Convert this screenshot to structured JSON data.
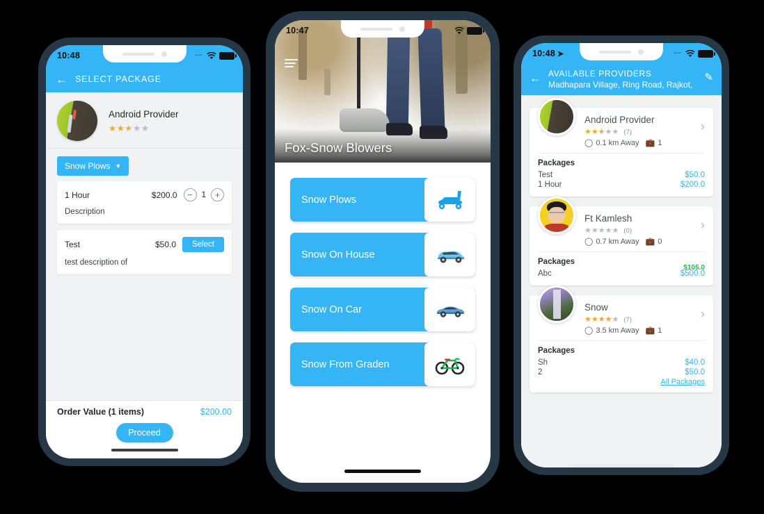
{
  "page": {
    "background": "#000000",
    "phone_frame_color": "#263746",
    "accent": "#35b5f5"
  },
  "phone_left": {
    "status": {
      "time": "10:48",
      "carrier_dots": "••••",
      "wifi_icon": "wifi-icon",
      "battery_icon": "battery-icon"
    },
    "appbar": {
      "back_icon": "back-arrow-icon",
      "title": "SELECT PACKAGE"
    },
    "provider": {
      "name": "Android Provider",
      "avatar_name": "provider-avatar",
      "rating": 2.5,
      "stars": "★★★★★"
    },
    "category_chip": {
      "label": "Snow Plows",
      "caret": "▼"
    },
    "packages": [
      {
        "name": "1 Hour",
        "price": "$200.0",
        "description": "Description",
        "qty": "1",
        "minus": "—",
        "plus": "+",
        "has_stepper": true
      },
      {
        "name": "Test",
        "price": "$50.0",
        "description": "test description of",
        "select_label": "Select",
        "has_stepper": false
      }
    ],
    "footer": {
      "order_label": "Order Value (1 items)",
      "order_value": "$200.00",
      "proceed_label": "Proceed"
    }
  },
  "phone_center": {
    "status": {
      "time": "10:47",
      "wifi_icon": "wifi-icon",
      "battery_icon": "battery-icon"
    },
    "hero": {
      "title": "Fox-Snow Blowers",
      "menu_icon": "hamburger-menu-icon"
    },
    "services": [
      {
        "label": "Snow Plows",
        "icon": "snow-plow-icon"
      },
      {
        "label": "Snow On House",
        "icon": "suv-car-icon"
      },
      {
        "label": "Snow On Car",
        "icon": "sedan-car-icon"
      },
      {
        "label": "Snow From Graden",
        "icon": "bicycle-icon"
      }
    ]
  },
  "phone_right": {
    "status": {
      "time": "10:48",
      "location_icon": "location-arrow-icon",
      "carrier_dots": "••••",
      "wifi_icon": "wifi-icon",
      "battery_icon": "battery-icon"
    },
    "appbar": {
      "back_icon": "back-arrow-icon",
      "title": "AVAILABLE PROVIDERS",
      "subtitle": "Madhapara Village, Ring Road, Rajkot,",
      "edit_icon": "pencil-edit-icon"
    },
    "providers": [
      {
        "name": "Android Provider",
        "avatar_name": "provider-avatar-android",
        "stars_filled": 2.5,
        "rating_count": "(7)",
        "distance": "0.1 km Away",
        "jobs": "1",
        "packages_label": "Packages",
        "packages": [
          {
            "name": "Test",
            "price": "$50.0"
          },
          {
            "name": "1 Hour",
            "price": "$200.0"
          }
        ],
        "extra_price": null,
        "all_packages": null
      },
      {
        "name": "Ft Kamlesh",
        "avatar_name": "provider-avatar-kamlesh",
        "stars_filled": 0,
        "rating_count": "(0)",
        "distance": "0.7 km Away",
        "jobs": "0",
        "packages_label": "Packages",
        "packages": [
          {
            "name": "Abc",
            "price": "$500.0"
          }
        ],
        "extra_price": "$105.0",
        "all_packages": null
      },
      {
        "name": "Snow",
        "avatar_name": "provider-avatar-snow",
        "stars_filled": 4,
        "rating_count": "(7)",
        "distance": "3.5 km Away",
        "jobs": "1",
        "packages_label": "Packages",
        "packages": [
          {
            "name": "Sh",
            "price": "$40.0"
          },
          {
            "name": "2",
            "price": "$50.0"
          }
        ],
        "extra_price": null,
        "all_packages": "All Packages"
      }
    ]
  }
}
